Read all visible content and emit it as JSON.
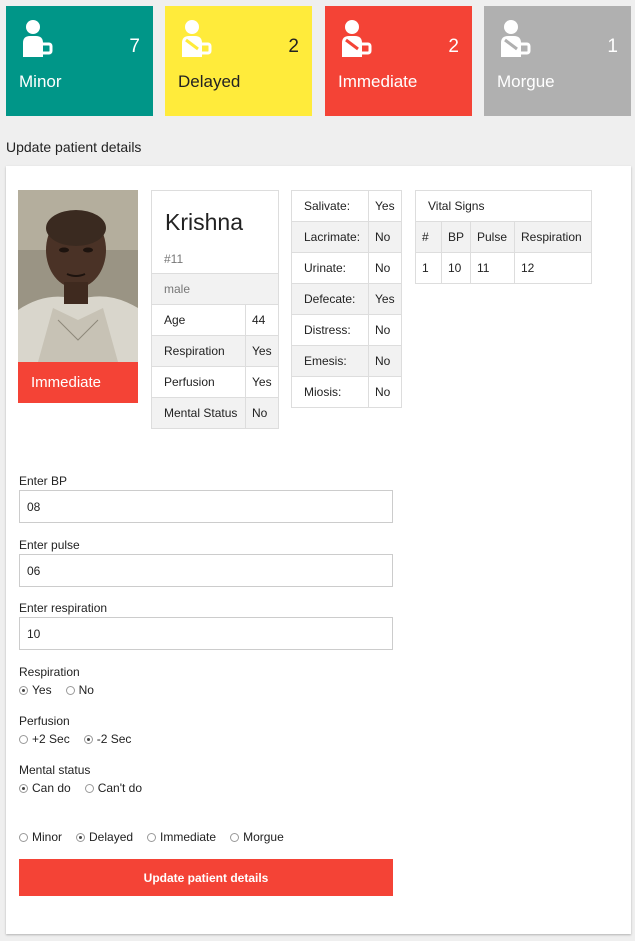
{
  "colors": {
    "minor": "#009688",
    "delayed": "#ffeb3b",
    "immediate": "#f44336",
    "morgue": "#b0b0b0",
    "accent": "#f44336"
  },
  "tiles": [
    {
      "label": "Minor",
      "count": "7",
      "icon": "patient-person-icon"
    },
    {
      "label": "Delayed",
      "count": "2",
      "icon": "patient-person-icon"
    },
    {
      "label": "Immediate",
      "count": "2",
      "icon": "patient-person-icon"
    },
    {
      "label": "Morgue",
      "count": "1",
      "icon": "patient-person-icon"
    }
  ],
  "page_title": "Update patient details",
  "patient": {
    "name": "Krishna",
    "id": "#11",
    "gender": "male",
    "status": "Immediate",
    "attributes": [
      {
        "label": "Age",
        "value": "44"
      },
      {
        "label": "Respiration",
        "value": "Yes"
      },
      {
        "label": "Perfusion",
        "value": "Yes"
      },
      {
        "label": "Mental Status",
        "value": "No"
      }
    ]
  },
  "symptoms": [
    {
      "label": "Salivate:",
      "value": "Yes"
    },
    {
      "label": "Lacrimate:",
      "value": "No"
    },
    {
      "label": "Urinate:",
      "value": "No"
    },
    {
      "label": "Defecate:",
      "value": "Yes"
    },
    {
      "label": "Distress:",
      "value": "No"
    },
    {
      "label": "Emesis:",
      "value": "No"
    },
    {
      "label": "Miosis:",
      "value": "No"
    }
  ],
  "vitals": {
    "title": "Vital Signs",
    "columns": [
      "#",
      "BP",
      "Pulse",
      "Respiration"
    ],
    "rows": [
      [
        "1",
        "10",
        "11",
        "12"
      ]
    ]
  },
  "form": {
    "bp_label": "Enter BP",
    "bp_value": "08",
    "pulse_label": "Enter pulse",
    "pulse_value": "06",
    "resp_label": "Enter respiration",
    "resp_value": "10",
    "respiration": {
      "label": "Respiration",
      "options": [
        "Yes",
        "No"
      ],
      "selected": "Yes"
    },
    "perfusion": {
      "label": "Perfusion",
      "options": [
        "+2 Sec",
        "-2 Sec"
      ],
      "selected": "-2 Sec"
    },
    "mental": {
      "label": "Mental status",
      "options": [
        "Can do",
        "Can't do"
      ],
      "selected": "Can do"
    },
    "category": {
      "options": [
        "Minor",
        "Delayed",
        "Immediate",
        "Morgue"
      ],
      "selected": "Delayed"
    },
    "submit_label": "Update patient details"
  }
}
